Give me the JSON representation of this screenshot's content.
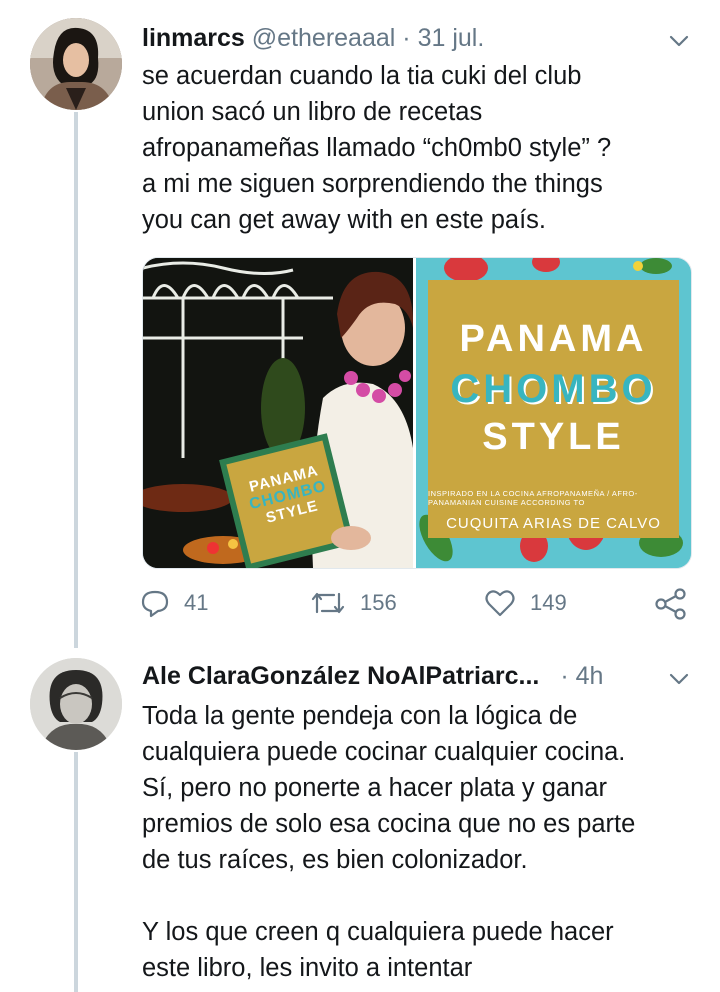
{
  "tweet1": {
    "name": "linmarcs",
    "handle": "@ethereaaal",
    "separator": "·",
    "time": "31 jul.",
    "text_lines": [
      "se acuerdan cuando la tia cuki del club",
      "union sacó un libro de recetas",
      "afropanameñas llamado “ch0mb0 style” ?",
      "a mi me siguen sorprendiendo the things",
      "you can get away with en este país."
    ],
    "media": {
      "book_title_line1": "PANAMA",
      "book_title_line2": "CHOMBO",
      "book_title_line3": "STYLE",
      "book_subtitle": "INSPIRADO EN LA COCINA AFROPANAMEÑA / AFRO-PANAMANIAN CUISINE ACCORDING TO",
      "book_author": "CUQUITA ARIAS DE CALVO",
      "held_book_line1": "PANAMA",
      "held_book_line2": "CHOMBO",
      "held_book_line3": "STYLE"
    },
    "actions": {
      "replies": "41",
      "retweets": "156",
      "likes": "149"
    }
  },
  "tweet2": {
    "name": "Ale ClaraGonzález NoAlPatriarc...",
    "separator": "·",
    "time": "4h",
    "text_lines": [
      "Toda la gente pendeja con la lógica de",
      "cualquiera puede cocinar cualquier cocina.",
      "Sí, pero no ponerte a hacer plata y ganar",
      "premios de solo esa cocina que no es parte",
      "de tus raíces, es bien colonizador.",
      "",
      "Y los que creen q cualquiera puede hacer",
      "este libro, les invito a intentar"
    ]
  },
  "colors": {
    "text_primary": "#14171a",
    "text_secondary": "#657786",
    "thread_line": "#ccd6dd",
    "book_gold": "#c9a640",
    "book_teal": "#38b5c0"
  },
  "icons": [
    "reply-icon",
    "retweet-icon",
    "like-icon",
    "share-icon",
    "chevron-down-icon"
  ]
}
